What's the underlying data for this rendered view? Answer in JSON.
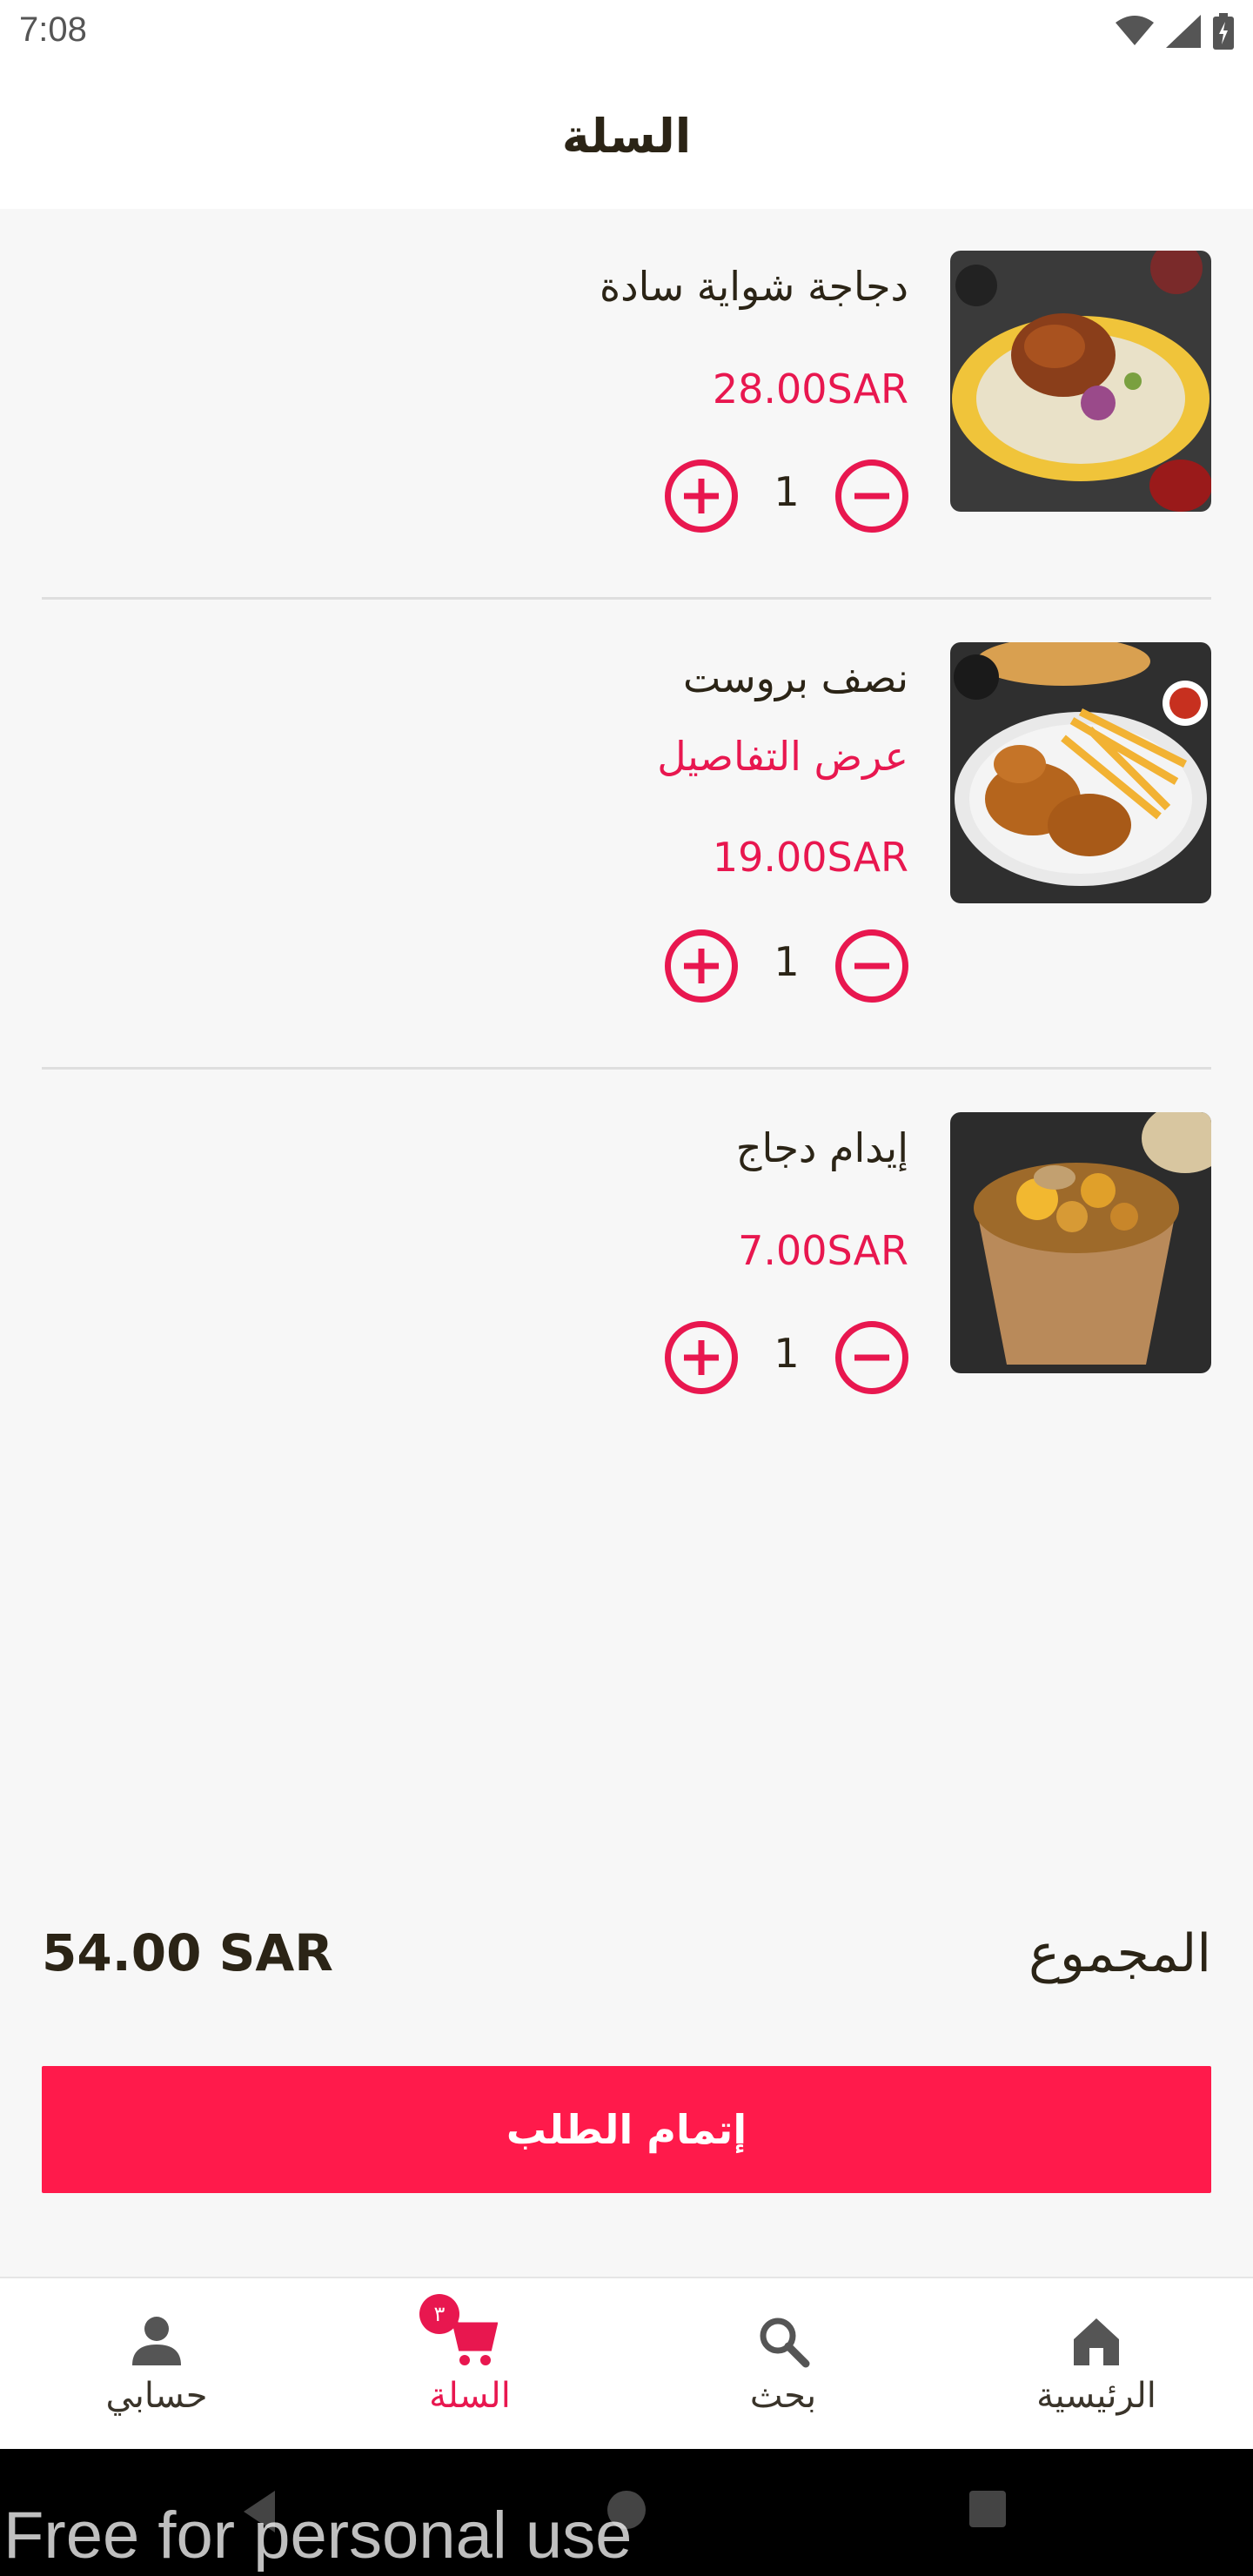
{
  "status_bar": {
    "time": "7:08"
  },
  "header": {
    "title": "السلة"
  },
  "cart": {
    "items": [
      {
        "name": "دجاجة شواية سادة",
        "details_link": "",
        "price": "28.00SAR",
        "quantity": "1"
      },
      {
        "name": "نصف بروست",
        "details_link": "عرض التفاصيل",
        "price": "19.00SAR",
        "quantity": "1"
      },
      {
        "name": "إيدام دجاج",
        "details_link": "",
        "price": "7.00SAR",
        "quantity": "1"
      }
    ]
  },
  "summary": {
    "total_label": "المجموع",
    "total_value": "54.00 SAR"
  },
  "checkout": {
    "label": "إتمام الطلب"
  },
  "bottom_nav": {
    "items": [
      {
        "label": "حسابي",
        "icon": "person-icon"
      },
      {
        "label": "السلة",
        "icon": "cart-icon",
        "badge": "٣",
        "active": true
      },
      {
        "label": "بحث",
        "icon": "search-icon"
      },
      {
        "label": "الرئيسية",
        "icon": "home-icon"
      }
    ]
  },
  "watermark": "Free for personal use",
  "colors": {
    "accent": "#e8174f",
    "button": "#ff1a4b",
    "text": "#2b2416"
  }
}
